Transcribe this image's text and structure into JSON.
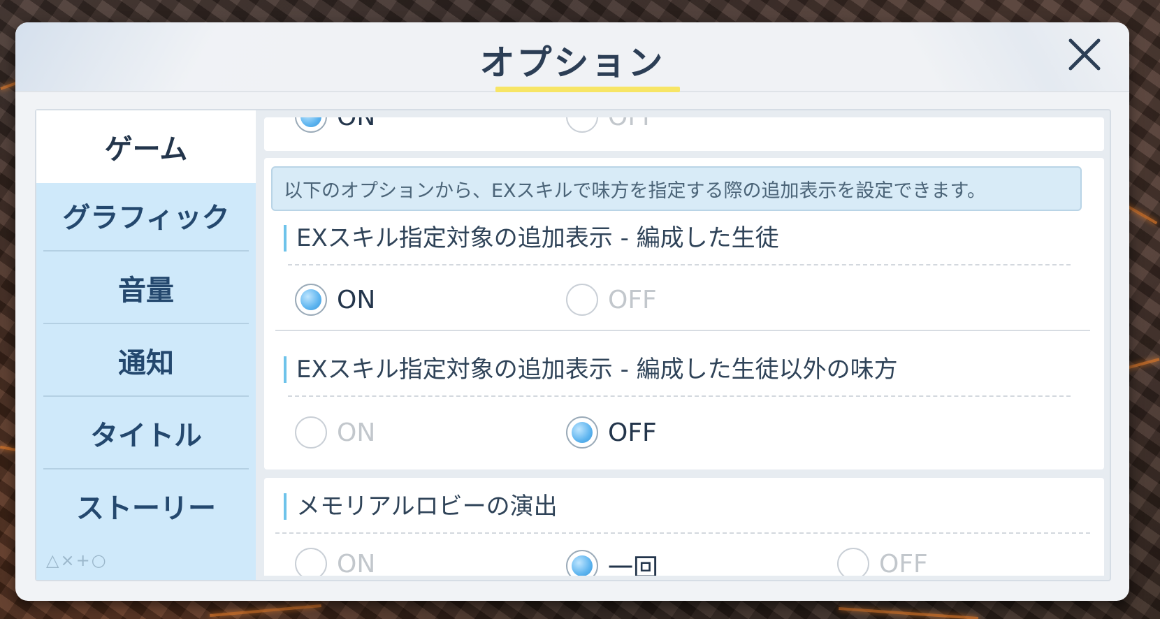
{
  "dialog": {
    "title": "オプション",
    "close_icon": "close-icon"
  },
  "sidebar": {
    "items": [
      {
        "label": "ゲーム",
        "active": true
      },
      {
        "label": "グラフィック",
        "active": false
      },
      {
        "label": "音量",
        "active": false
      },
      {
        "label": "通知",
        "active": false
      },
      {
        "label": "タイトル",
        "active": false
      },
      {
        "label": "ストーリー",
        "active": false
      }
    ],
    "decoration": "△×+○"
  },
  "content": {
    "top_partial": {
      "on_label": "ON",
      "off_label": "OFF",
      "selected": "ON"
    },
    "info": "以下のオプションから、EXスキルで味方を指定する際の追加表示を設定できます。",
    "settings": [
      {
        "title": "EXスキル指定対象の追加表示 - 編成した生徒",
        "options": [
          "ON",
          "OFF"
        ],
        "selected": "ON"
      },
      {
        "title": "EXスキル指定対象の追加表示 - 編成した生徒以外の味方",
        "options": [
          "ON",
          "OFF"
        ],
        "selected": "OFF"
      }
    ],
    "memorial": {
      "title": "メモリアルロビーの演出",
      "options": [
        "ON",
        "一回",
        "OFF"
      ],
      "selected": "一回"
    }
  },
  "colors": {
    "accent_blue": "#5db4ef",
    "sidebar_bg": "#cfe9fa",
    "title_underline": "#f7e565",
    "text_dark": "#23354b"
  }
}
